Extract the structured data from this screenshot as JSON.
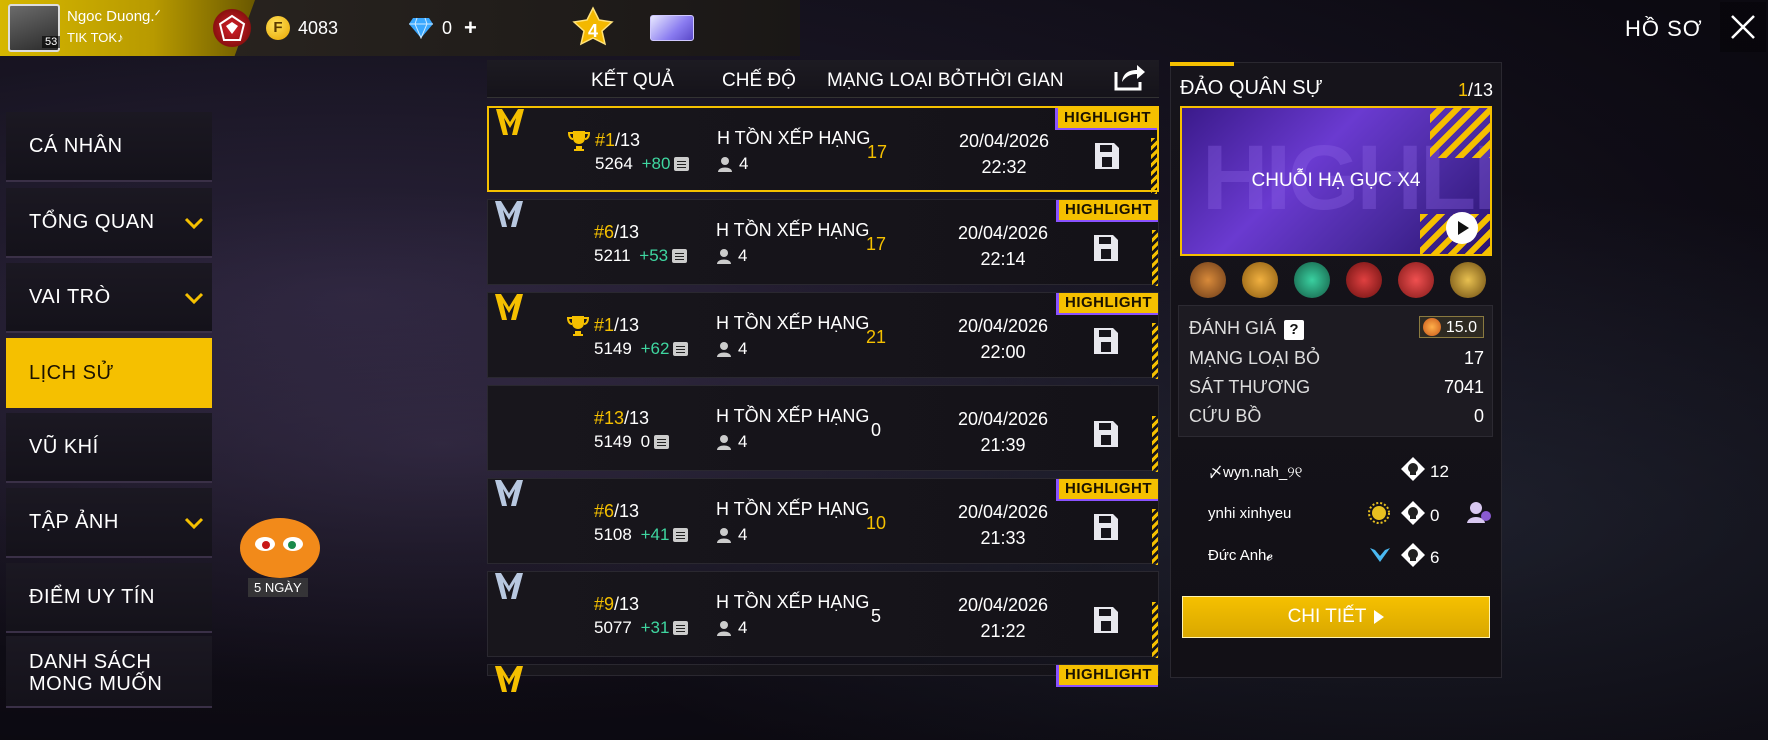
{
  "player": {
    "name": "Ngoc Duong.ᐟ",
    "subtitle": "TIK   TOK♪",
    "level": "53"
  },
  "currency": {
    "gold": "4083",
    "diamonds": "0",
    "plus": "+"
  },
  "rank_badge_number": "4",
  "header": {
    "title": "HỒ SƠ"
  },
  "menu": [
    {
      "label": "CÁ NHÂN",
      "has_chevron": false
    },
    {
      "label": "TỔNG QUAN",
      "has_chevron": true
    },
    {
      "label": "VAI TRÒ",
      "has_chevron": true
    },
    {
      "label": "LỊCH SỬ",
      "has_chevron": false,
      "active": true
    },
    {
      "label": "VŨ KHÍ",
      "has_chevron": false
    },
    {
      "label": "TẬP ẢNH",
      "has_chevron": true
    },
    {
      "label": "ĐIỂM UY TÍN",
      "has_chevron": false
    },
    {
      "label": "DANH SÁCH MONG MUỐN",
      "has_chevron": false
    }
  ],
  "pet": {
    "days": "5 NGÀY"
  },
  "table": {
    "headers": {
      "result": "KẾT QUẢ",
      "mode": "CHẾ ĐỘ",
      "kills": "MẠNG LOẠI BỎ",
      "time": "THỜI GIAN"
    },
    "rows": [
      {
        "rank": "#1",
        "total": "/13",
        "score": "5264",
        "delta": "+80",
        "mode": "H TỒN XẾP HẠNG",
        "team": "4",
        "kills": "17",
        "date": "20/04/2026",
        "time": "22:32",
        "highlight": "HIGHLIGHT",
        "trophy": true,
        "mode_color": "gold"
      },
      {
        "rank": "#6",
        "total": "/13",
        "score": "5211",
        "delta": "+53",
        "mode": "H TỒN XẾP HẠNG",
        "team": "4",
        "kills": "17",
        "date": "20/04/2026",
        "time": "22:14",
        "highlight": "HIGHLIGHT",
        "trophy": false,
        "mode_color": "silver"
      },
      {
        "rank": "#1",
        "total": "/13",
        "score": "5149",
        "delta": "+62",
        "mode": "H TỒN XẾP HẠNG",
        "team": "4",
        "kills": "21",
        "date": "20/04/2026",
        "time": "22:00",
        "highlight": "HIGHLIGHT",
        "trophy": true,
        "mode_color": "gold"
      },
      {
        "rank": "#13",
        "total": "/13",
        "score": "5149",
        "delta": "0",
        "mode": "H TỒN XẾP HẠNG",
        "team": "4",
        "kills": "0",
        "date": "20/04/2026",
        "time": "21:39",
        "highlight": "",
        "trophy": false,
        "mode_color": "none"
      },
      {
        "rank": "#6",
        "total": "/13",
        "score": "5108",
        "delta": "+41",
        "mode": "H TỒN XẾP HẠNG",
        "team": "4",
        "kills": "10",
        "date": "20/04/2026",
        "time": "21:33",
        "highlight": "HIGHLIGHT",
        "trophy": false,
        "mode_color": "silver"
      },
      {
        "rank": "#9",
        "total": "/13",
        "score": "5077",
        "delta": "+31",
        "mode": "H TỒN XẾP HẠNG",
        "team": "4",
        "kills": "5",
        "date": "20/04/2026",
        "time": "21:22",
        "highlight": "",
        "trophy": false,
        "mode_color": "silver"
      },
      {
        "rank": "",
        "total": "",
        "score": "",
        "delta": "",
        "mode": "",
        "team": "",
        "kills": "",
        "date": "",
        "time": "",
        "highlight": "HIGHLIGHT",
        "trophy": false,
        "mode_color": "gold"
      }
    ]
  },
  "detail": {
    "map": "ĐẢO QUÂN SỰ",
    "page_current": "1",
    "page_total": "/13",
    "card_label": "CHUỖI HẠ GỤC X4",
    "card_watermark": "HIGHLIGHT",
    "stats": [
      {
        "label": "ĐÁNH GIÁ",
        "value": "15.0"
      },
      {
        "label": "MẠNG LOẠI BỎ",
        "value": "17"
      },
      {
        "label": "SÁT THƯƠNG",
        "value": "7041"
      },
      {
        "label": "CỨU BỒ",
        "value": "0"
      }
    ],
    "help": "?",
    "team": [
      {
        "name": "〆wyn.nah_୨୧",
        "kills": "12"
      },
      {
        "name": "ynhi xinhyeu",
        "kills": "0"
      },
      {
        "name": "Đức Anh𝓮",
        "kills": "6"
      }
    ],
    "button": "CHI TIẾT"
  },
  "colors": {
    "accent": "#f5c000",
    "delta": "#3fd6a0",
    "highlight_border": "#8a52ff"
  }
}
